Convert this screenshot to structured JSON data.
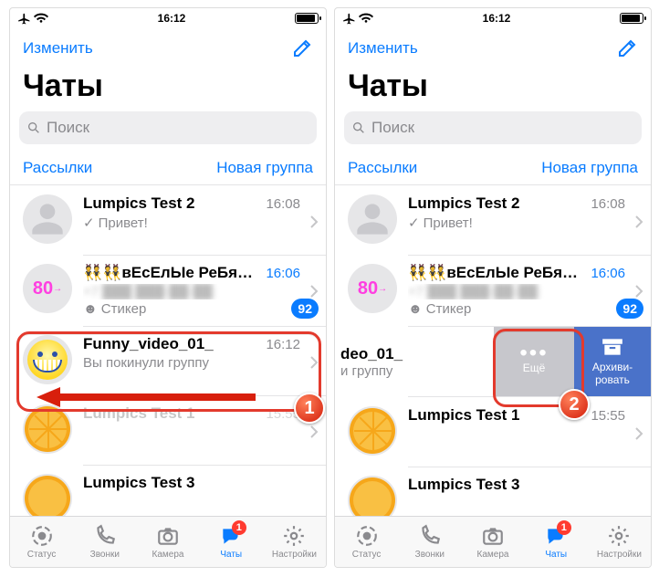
{
  "statusbar": {
    "time": "16:12"
  },
  "nav": {
    "edit": "Изменить"
  },
  "title": "Чаты",
  "search_placeholder": "Поиск",
  "subnav": {
    "broadcasts": "Рассылки",
    "newgroup": "Новая группа"
  },
  "chats_left": [
    {
      "title": "Lumpics Test 2",
      "time": "16:08",
      "sub_prefix": "tick",
      "sub": "Привет!"
    },
    {
      "title": "👯👯вЕсЕлЫе РеБя…",
      "time": "16:06",
      "time_active": true,
      "line2": "+7 ███ ███-██-██:",
      "sub_prefix": "mic",
      "sub": "Стикер",
      "badge": "92"
    },
    {
      "title": "Funny_video_01_",
      "time": "16:12",
      "sub": "Вы покинули группу"
    },
    {
      "title": "Lumpics Test 1",
      "time": "15:55"
    },
    {
      "title": "Lumpics Test 3",
      "time": ""
    }
  ],
  "chats_right": [
    {
      "title": "Lumpics Test 2",
      "time": "16:08",
      "sub_prefix": "tick",
      "sub": "Привет!"
    },
    {
      "title": "👯👯вЕсЕлЫе РеБя…",
      "time": "16:06",
      "time_active": true,
      "line2": "+7 ███ ███-██-██:",
      "sub_prefix": "mic",
      "sub": "Стикер",
      "badge": "92"
    },
    {
      "frag_title": "deo_01_",
      "frag_sub": "и группу",
      "more": "Ещё",
      "archive_l1": "Архиви-",
      "archive_l2": "ровать"
    },
    {
      "title": "Lumpics Test 1",
      "time": "15:55"
    },
    {
      "title": "Lumpics Test 3",
      "time": ""
    }
  ],
  "tabs": {
    "status": "Статус",
    "calls": "Звонки",
    "camera": "Камера",
    "chats": "Чаты",
    "settings": "Настройки",
    "chats_badge": "1"
  },
  "callouts": {
    "n1": "1",
    "n2": "2"
  }
}
